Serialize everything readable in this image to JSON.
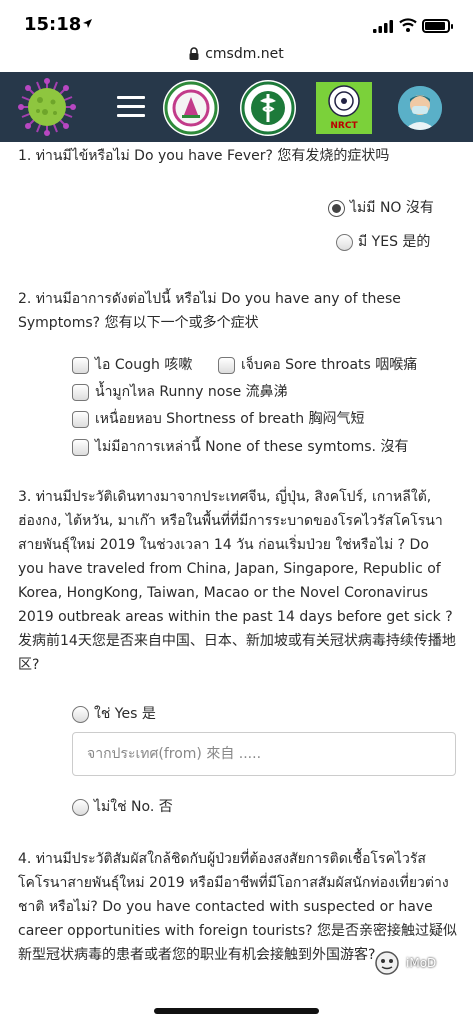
{
  "status_bar": {
    "time": "15:18"
  },
  "browser": {
    "url": "cmsdm.net"
  },
  "header": {
    "nrct_label": "NRCT"
  },
  "q1": {
    "text": "1. ท่านมีไข้หรือไม่ Do you have Fever? 您有发烧的症状吗",
    "options": [
      "ไม่มี NO 沒有",
      "มี YES 是的"
    ]
  },
  "q2": {
    "text": "2. ท่านมีอาการดังต่อไปนี้ หรือไม่ Do you have any of these Symptoms? 您有以下一个或多个症状",
    "options": [
      "ไอ Cough 咳嗽",
      "เจ็บคอ Sore throats 咽喉痛",
      "น้ำมูกไหล Runny nose 流鼻涕",
      "เหนื่อยหอบ Shortness of breath 胸闷气短",
      "ไม่มีอาการเหล่านี้ None of these symtoms. 沒有"
    ]
  },
  "q3": {
    "text": "3. ท่านมีประวัติเดินทางมาจากประเทศจีน, ญี่ปุ่น, สิงคโปร์, เกาหลีใต้, ฮ่องกง, ไต้หวัน, มาเก๊า หรือในพื้นที่ที่มีการระบาดของโรคไวรัสโคโรนาสายพันธุ์ใหม่ 2019 ในช่วงเวลา 14 วัน ก่อนเริ่มป่วย ใช่หรือไม่ ? Do you have traveled from China, Japan, Singapore, Republic of Korea, HongKong, Taiwan, Macao or the Novel Coronavirus 2019 outbreak areas within the past 14 days before get sick ? 发病前14天您是否来自中国、日本、新加坡或有关冠状病毒持续传播地区?",
    "options": [
      "ใช่ Yes 是",
      "ไม่ใช่ No. 否"
    ],
    "input_placeholder": "จากประเทศ(from) 來自 ....."
  },
  "q4": {
    "text": "4. ท่านมีประวัติสัมผัสใกล้ชิดกับผู้ป่วยที่ต้องสงสัยการติดเชื้อโรคไวรัสโคโรนาสายพันธุ์ใหม่ 2019 หรือมีอาชีพที่มีโอกาสสัมผัสนักท่องเที่ยวต่างชาติ หรือไม่? Do you have contacted with suspected or have career opportunities with foreign tourists? 您是否亲密接触过疑似新型冠状病毒的患者或者您的职业有机会接触到外国游客?"
  },
  "watermark": {
    "text": "iMoD"
  }
}
